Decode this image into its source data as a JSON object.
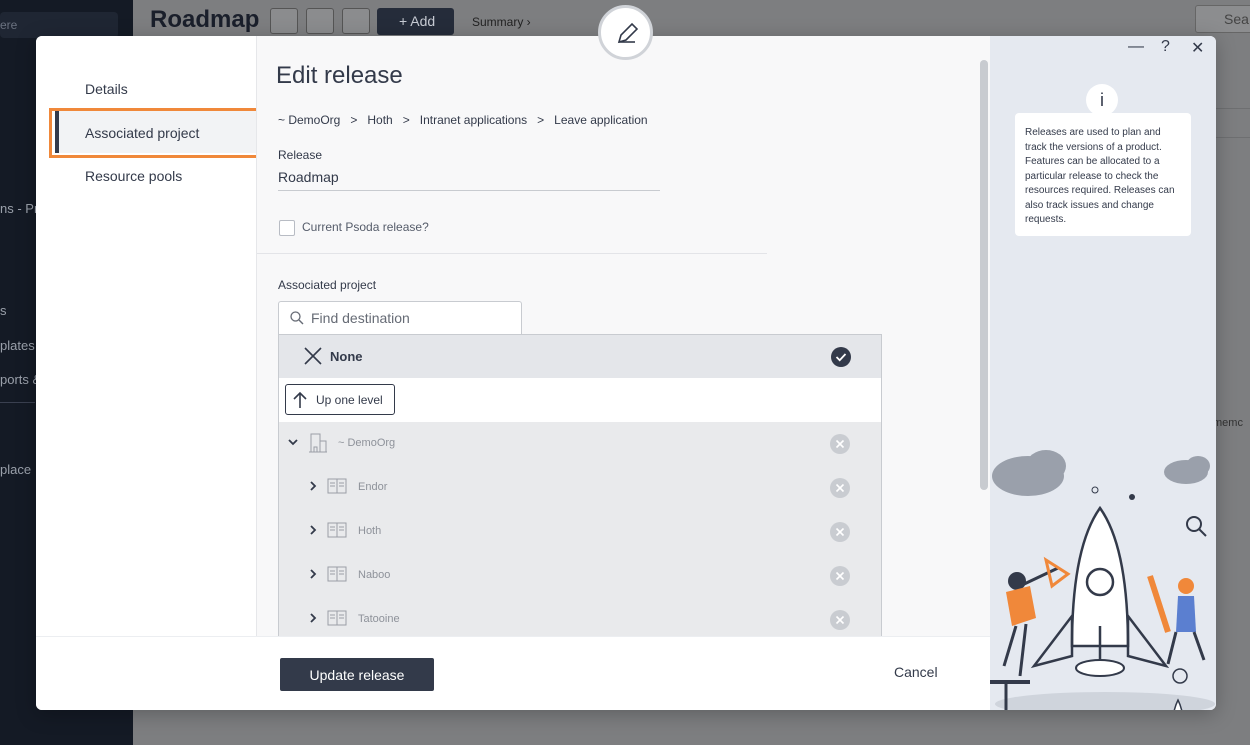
{
  "background": {
    "page_title": "Roadmap",
    "add_label": "+ Add",
    "summary_label": "Summary ›",
    "search_label": "Sea",
    "sidebar_search": "ere",
    "sidebar_items": [
      "ns - Pr",
      "s",
      "plates",
      "ports &",
      "place"
    ],
    "right_text": "memc"
  },
  "modal": {
    "nav": {
      "details": "Details",
      "associated_project": "Associated project",
      "resource_pools": "Resource pools"
    },
    "title": "Edit release",
    "breadcrumb": [
      "~ DemoOrg",
      "Hoth",
      "Intranet applications",
      "Leave application"
    ],
    "breadcrumb_sep": ">",
    "release_label": "Release",
    "release_value": "Roadmap",
    "current_release_label": "Current Psoda release?",
    "associated_project_label": "Associated project",
    "find_placeholder": "Find destination",
    "none_label": "None",
    "up_one_level_label": "Up one level",
    "tree": [
      {
        "label": "~ DemoOrg",
        "expanded": true
      },
      {
        "label": "Endor"
      },
      {
        "label": "Hoth"
      },
      {
        "label": "Naboo"
      },
      {
        "label": "Tatooine"
      }
    ],
    "update_button": "Update release",
    "cancel_button": "Cancel",
    "info_text": "Releases are used to plan and track the versions of a product. Features can be allocated to a particular release to check the resources required. Releases can also track issues and change requests.",
    "info_icon_text": "i",
    "window_controls": {
      "minimize": "—",
      "help": "?",
      "close": "✕"
    }
  },
  "colors": {
    "accent_dark": "#333a4a",
    "highlight": "#f0883a",
    "side_panel": "#e5e9f0",
    "rocket_orange": "#f0883a",
    "rocket_blue": "#5b7fd0"
  }
}
